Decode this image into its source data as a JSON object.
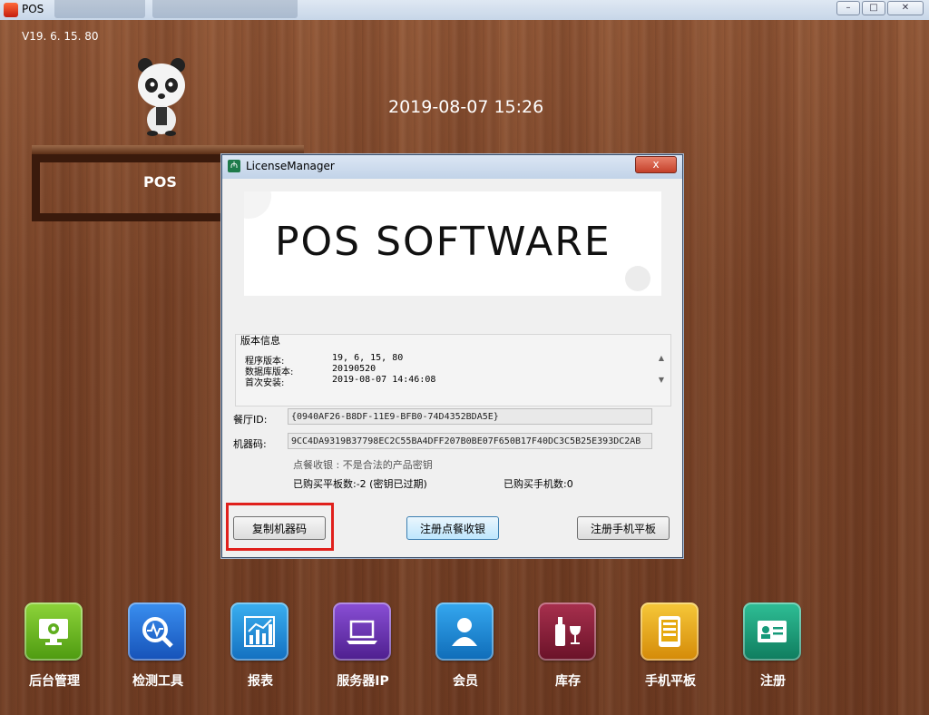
{
  "window": {
    "title": "POS"
  },
  "header": {
    "version": "V19. 6. 15. 80",
    "datetime": "2019-08-07 15:26",
    "pos_label": "POS"
  },
  "dialog": {
    "title": "LicenseManager",
    "close_label": "x",
    "banner_text": "POS SOFTWARE",
    "version_info": {
      "legend": "版本信息",
      "rows": [
        {
          "label": "程序版本:",
          "value": "19, 6, 15, 80"
        },
        {
          "label": "数据库版本:",
          "value": "20190520"
        },
        {
          "label": "首次安装:",
          "value": "2019-08-07 14:46:08"
        }
      ]
    },
    "restaurant_id_label": "餐厅ID:",
    "restaurant_id": "{0940AF26-B8DF-11E9-BFB0-74D4352BDA5E}",
    "machine_code_label": "机器码:",
    "machine_code": "9CC4DA9319B37798EC2C55BA4DFF207B0BE07F650B17F40DC3C5B25E393DC2AB",
    "status_line": "点餐收银  :  不是合法的产品密钥",
    "tablets_purchased": "已购买平板数:-2 (密钥已过期)",
    "phones_purchased": "已购买手机数:0",
    "buttons": {
      "copy": "复制机器码",
      "register_pos": "注册点餐收银",
      "register_mobile": "注册手机平板"
    }
  },
  "tiles": [
    {
      "label": "后台管理",
      "icon": "monitor-gear-icon",
      "color": "#5fae1e"
    },
    {
      "label": "检测工具",
      "icon": "search-pulse-icon",
      "color": "#1e6fd0"
    },
    {
      "label": "报表",
      "icon": "bar-chart-icon",
      "color": "#1d8fd6"
    },
    {
      "label": "服务器IP",
      "icon": "laptop-icon",
      "color": "#6a2fb0"
    },
    {
      "label": "会员",
      "icon": "person-icon",
      "color": "#1a8ad4"
    },
    {
      "label": "库存",
      "icon": "wine-icon",
      "color": "#8a1f3a"
    },
    {
      "label": "手机平板",
      "icon": "tablet-icon",
      "color": "#e6a90f"
    },
    {
      "label": "注册",
      "icon": "id-card-icon",
      "color": "#169a7a"
    }
  ]
}
